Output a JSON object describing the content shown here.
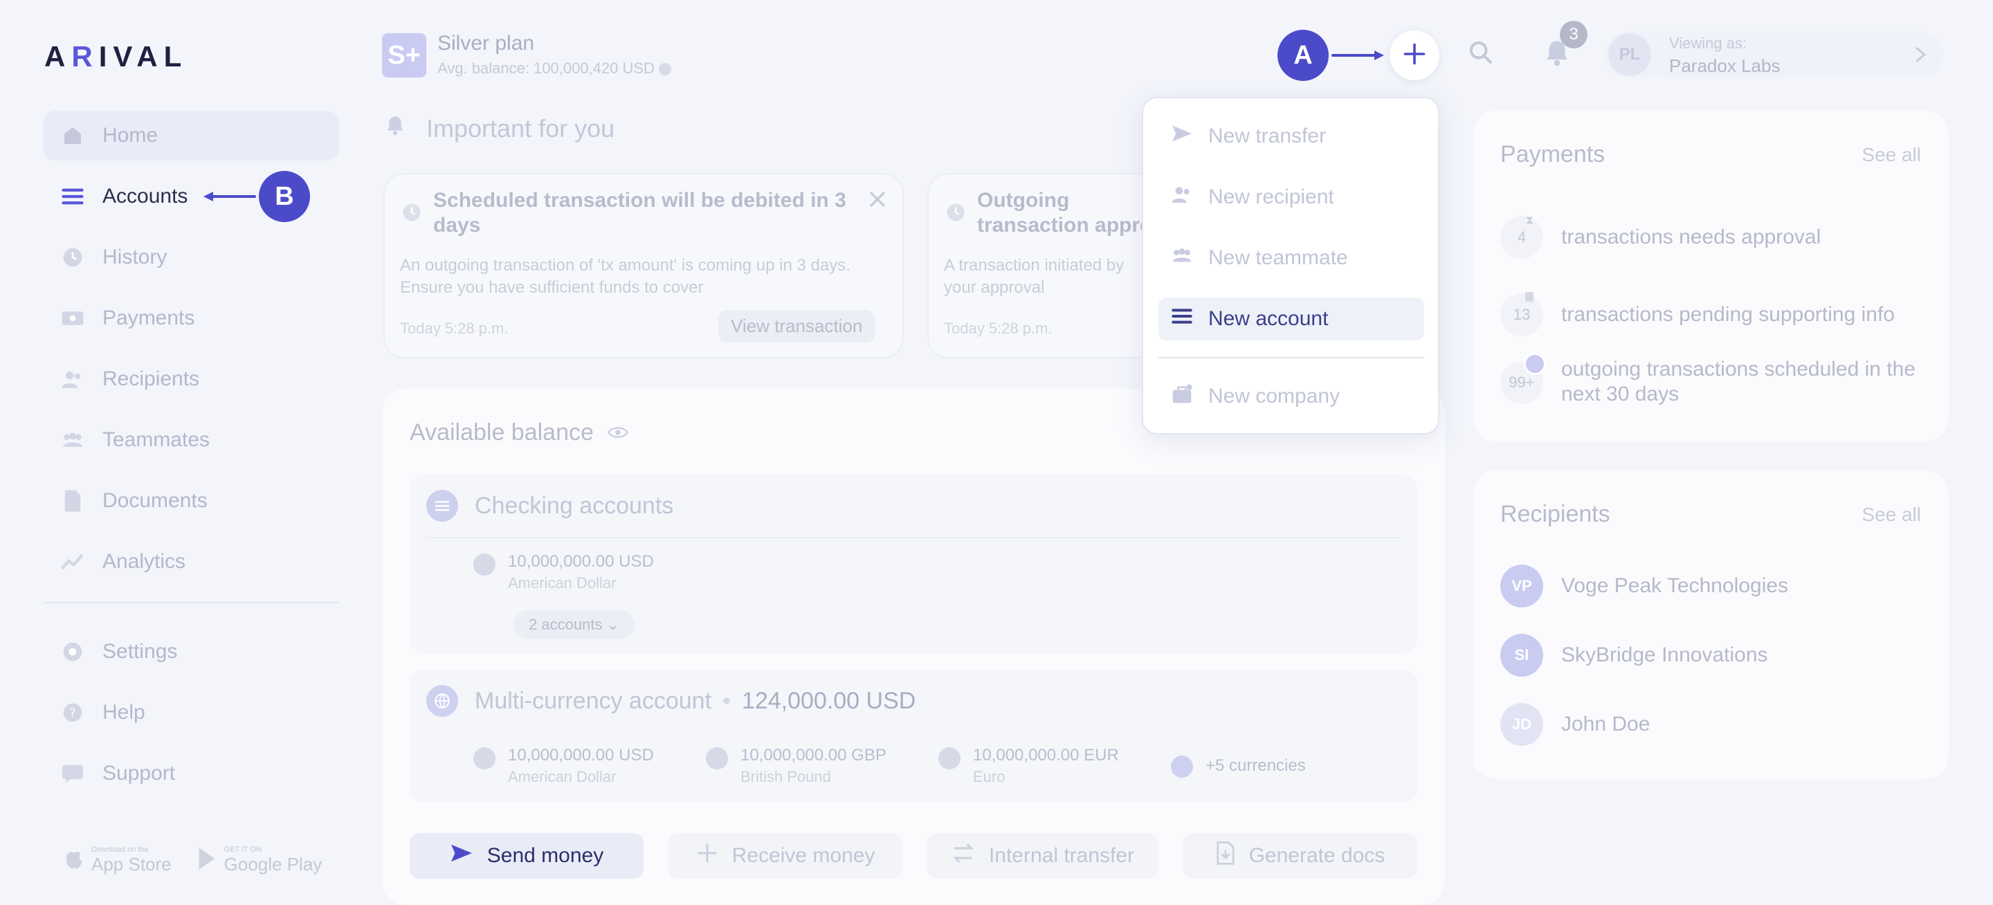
{
  "brand": {
    "logo": "ARIVAL",
    "logo_pre": "A",
    "logo_accent": "R",
    "logo_post": "IVAL"
  },
  "colors": {
    "accent": "#4b4bc9",
    "faded_text": "#b3b8cc",
    "background": "#f3f5fb"
  },
  "sidebar": {
    "items": [
      {
        "label": "Home",
        "icon": "home-icon"
      },
      {
        "label": "Accounts",
        "icon": "list-icon"
      },
      {
        "label": "History",
        "icon": "clock-icon"
      },
      {
        "label": "Payments",
        "icon": "payments-icon"
      },
      {
        "label": "Recipients",
        "icon": "users-icon"
      },
      {
        "label": "Teammates",
        "icon": "team-icon"
      },
      {
        "label": "Documents",
        "icon": "document-icon"
      },
      {
        "label": "Analytics",
        "icon": "analytics-icon"
      }
    ],
    "bottom_items": [
      {
        "label": "Settings",
        "icon": "gear-icon"
      },
      {
        "label": "Help",
        "icon": "help-icon"
      },
      {
        "label": "Support",
        "icon": "chat-icon"
      }
    ],
    "stores": [
      {
        "small": "Download on the",
        "big": "App Store"
      },
      {
        "small": "GET IT ON",
        "big": "Google Play"
      }
    ]
  },
  "header": {
    "plan_badge": "S+",
    "plan_title": "Silver plan",
    "plan_sub": "Avg. balance: 100,000,420 USD",
    "notif_count": "3",
    "user_initials": "PL",
    "viewing_as": "Viewing as:",
    "company": "Paradox Labs"
  },
  "important": {
    "title": "Important for you",
    "cards": [
      {
        "title": "Scheduled transaction will be debited in 3 days",
        "body": "An outgoing transaction of 'tx amount' is coming up in 3 days. Ensure you have sufficient funds to cover",
        "time": "Today 5:28 p.m.",
        "action": "View transaction"
      },
      {
        "title": "Outgoing transaction approval",
        "body": "A transaction initiated by your approval",
        "time": "Today 5:28 p.m."
      }
    ]
  },
  "balance": {
    "title": "Available balance",
    "checking": {
      "title": "Checking accounts",
      "amount": "10,000,000.00 USD",
      "currency": "American Dollar",
      "accounts_pill": "2 accounts"
    },
    "multi": {
      "title": "Multi-currency account",
      "separator": "•",
      "total": "124,000.00 USD",
      "currencies": [
        {
          "amount": "10,000,000.00 USD",
          "name": "American Dollar"
        },
        {
          "amount": "10,000,000.00 GBP",
          "name": "British Pound"
        },
        {
          "amount": "10,000,000.00 EUR",
          "name": "Euro"
        }
      ],
      "more": "+5 currencies"
    },
    "actions": [
      "Send money",
      "Receive money",
      "Internal transfer",
      "Generate docs"
    ]
  },
  "payments": {
    "title": "Payments",
    "see_all": "See all",
    "rows": [
      {
        "count": "4",
        "text": "transactions needs approval"
      },
      {
        "count": "13",
        "text": "transactions pending supporting info"
      },
      {
        "count": "99+",
        "text": "outgoing transactions scheduled in the next 30 days"
      }
    ]
  },
  "recipients": {
    "title": "Recipients",
    "see_all": "See all",
    "rows": [
      {
        "initials": "VP",
        "name": "Voge Peak Technologies"
      },
      {
        "initials": "SI",
        "name": "SkyBridge Innovations"
      },
      {
        "initials": "JD",
        "name": "John Doe"
      }
    ]
  },
  "menu": {
    "items": [
      {
        "label": "New transfer",
        "icon": "send-icon"
      },
      {
        "label": "New recipient",
        "icon": "user-icon"
      },
      {
        "label": "New teammate",
        "icon": "team-icon"
      },
      {
        "label": "New account",
        "icon": "list-icon",
        "selected": true
      },
      {
        "label": "New company",
        "icon": "briefcase-icon"
      }
    ]
  },
  "annotations": {
    "a": "A",
    "b": "B"
  }
}
